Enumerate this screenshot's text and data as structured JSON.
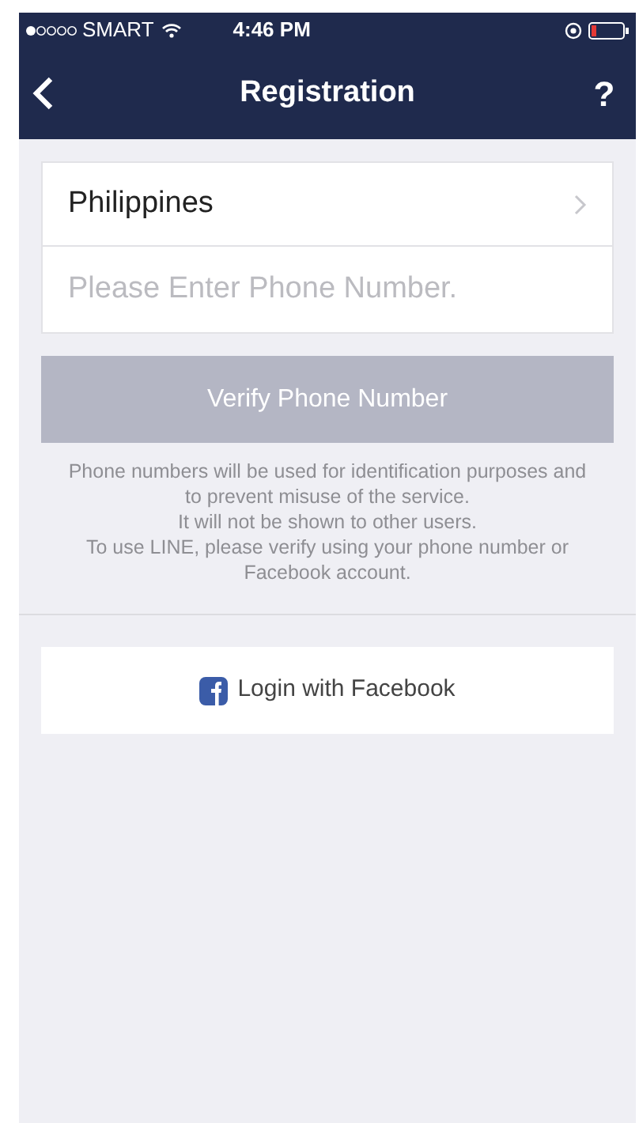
{
  "status_bar": {
    "carrier": "SMART",
    "time": "4:46 PM"
  },
  "nav_bar": {
    "title": "Registration",
    "help": "?"
  },
  "country": {
    "label": "Philippines"
  },
  "phone_field": {
    "placeholder": "Please Enter Phone Number."
  },
  "verify_button": {
    "label": "Verify Phone Number",
    "disabled": true
  },
  "notice": [
    "Phone numbers will be used for identification purposes and to prevent misuse of the service.",
    "It will not be shown to other users.",
    "To use LINE, please verify using your phone number or Facebook account."
  ],
  "facebook_button": {
    "label": "Login with Facebook"
  }
}
